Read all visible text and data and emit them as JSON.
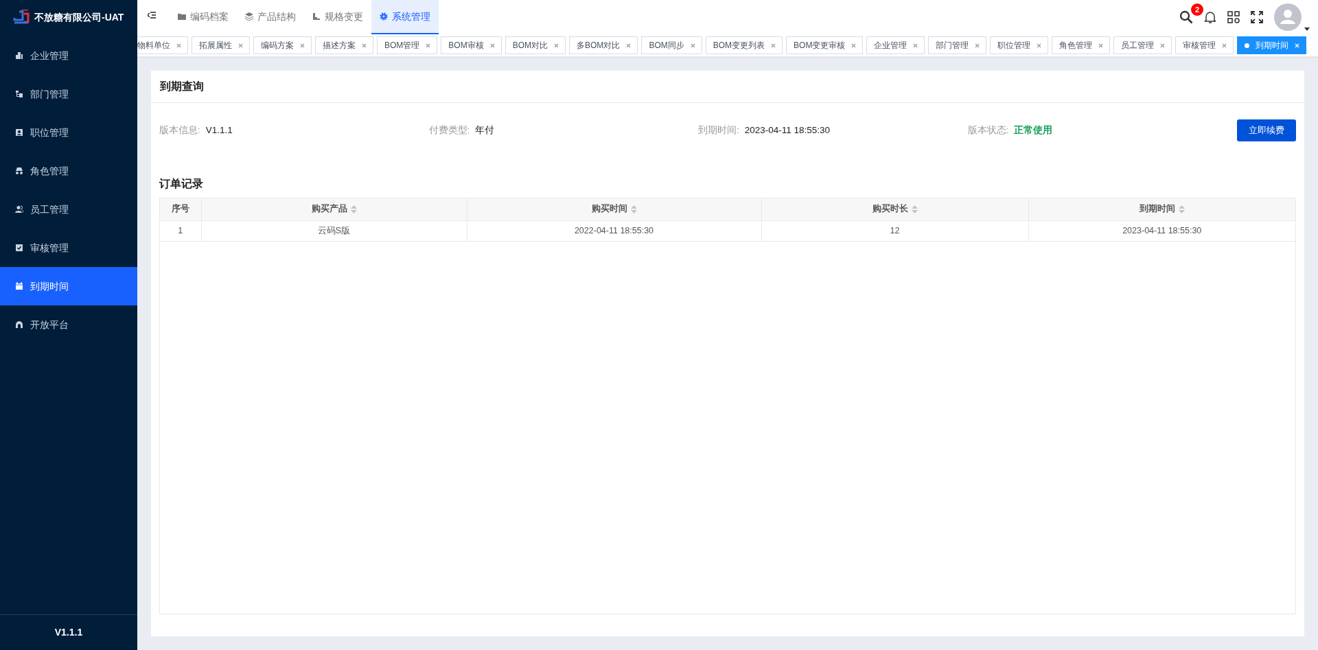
{
  "sidebar": {
    "brand": "不放糖有限公司-UAT",
    "items": [
      {
        "label": "企业管理",
        "selected": false
      },
      {
        "label": "部门管理",
        "selected": false
      },
      {
        "label": "职位管理",
        "selected": false
      },
      {
        "label": "角色管理",
        "selected": false
      },
      {
        "label": "员工管理",
        "selected": false
      },
      {
        "label": "审核管理",
        "selected": false
      },
      {
        "label": "到期时间",
        "selected": true
      },
      {
        "label": "开放平台",
        "selected": false
      }
    ],
    "version": "V1.1.1"
  },
  "top_menu": [
    {
      "label": "编码档案",
      "selected": false
    },
    {
      "label": "产品结构",
      "selected": false
    },
    {
      "label": "规格变更",
      "selected": false
    },
    {
      "label": "系统管理",
      "selected": true
    }
  ],
  "notifications": {
    "count": "2"
  },
  "tags": [
    {
      "label": "物料单位",
      "selected": false
    },
    {
      "label": "拓展属性",
      "selected": false
    },
    {
      "label": "编码方案",
      "selected": false
    },
    {
      "label": "描述方案",
      "selected": false
    },
    {
      "label": "BOM管理",
      "selected": false
    },
    {
      "label": "BOM审核",
      "selected": false
    },
    {
      "label": "BOM对比",
      "selected": false
    },
    {
      "label": "多BOM对比",
      "selected": false
    },
    {
      "label": "BOM同步",
      "selected": false
    },
    {
      "label": "BOM变更列表",
      "selected": false
    },
    {
      "label": "BOM变更审核",
      "selected": false
    },
    {
      "label": "企业管理",
      "selected": false
    },
    {
      "label": "部门管理",
      "selected": false
    },
    {
      "label": "职位管理",
      "selected": false
    },
    {
      "label": "角色管理",
      "selected": false
    },
    {
      "label": "员工管理",
      "selected": false
    },
    {
      "label": "审核管理",
      "selected": false
    },
    {
      "label": "到期时间",
      "selected": true
    }
  ],
  "card": {
    "title": "到期查询",
    "info": [
      {
        "label": "版本信息:",
        "value": "V1.1.1",
        "kind": "plain"
      },
      {
        "label": "付费类型:",
        "value": "年付",
        "kind": "plain"
      },
      {
        "label": "到期时间:",
        "value": "2023-04-11 18:55:30",
        "kind": "plain"
      },
      {
        "label": "版本状态:",
        "value": "正常使用",
        "kind": "status"
      }
    ],
    "button": "立即续费",
    "orders_title": "订单记录",
    "table": {
      "columns": [
        {
          "label": "序号",
          "sortable": false
        },
        {
          "label": "购买产品",
          "sortable": true
        },
        {
          "label": "购买时间",
          "sortable": true
        },
        {
          "label": "购买时长",
          "sortable": true
        },
        {
          "label": "到期时间",
          "sortable": true
        }
      ],
      "rows": [
        [
          "1",
          "云码S版",
          "2022-04-11 18:55:30",
          "12",
          "2023-04-11 18:55:30"
        ]
      ]
    }
  }
}
